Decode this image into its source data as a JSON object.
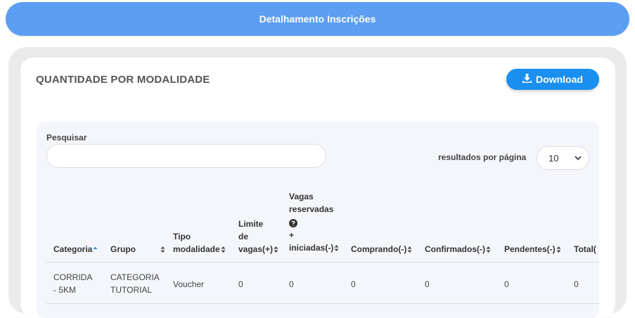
{
  "header": {
    "title": "Detalhamento Inscrições"
  },
  "card": {
    "title": "QUANTIDADE POR MODALIDADE",
    "download_label": "Download"
  },
  "table_controls": {
    "search_label": "Pesquisar",
    "search_value": "",
    "results_per_page_label": "resultados por página",
    "results_per_page_value": "10"
  },
  "columns": [
    {
      "label": "Categoria",
      "sort": "asc"
    },
    {
      "label": "Grupo",
      "sort": "none"
    },
    {
      "label": "Tipo\nmodalidade",
      "sort": "none"
    },
    {
      "label": "Limite\nde\nvagas(+)",
      "sort": "none"
    },
    {
      "label_top": "Vagas\nreservadas",
      "label_bottom": "+\niniciadas(-)",
      "sort": "none",
      "help_icon": "question-circle-icon"
    },
    {
      "label": "Comprando(-)",
      "sort": "none"
    },
    {
      "label": "Confirmados(-)",
      "sort": "none"
    },
    {
      "label": "Pendentes(-)",
      "sort": "none"
    },
    {
      "label": "Total(",
      "sort": "none"
    }
  ],
  "rows": [
    {
      "categoria": "CORRIDA\n- 5KM",
      "grupo": "CATEGORIA\nTUTORIAL",
      "tipo_modalidade": "Voucher",
      "limite_vagas": "0",
      "vagas_reservadas": "0",
      "comprando": "0",
      "confirmados": "0",
      "pendentes": "0",
      "total": "0"
    }
  ],
  "colors": {
    "header_bar": "#5b9ef2",
    "download_button": "#1a8ff0",
    "sort_active": "#2f8fe8",
    "sort_inactive": "#444444"
  }
}
